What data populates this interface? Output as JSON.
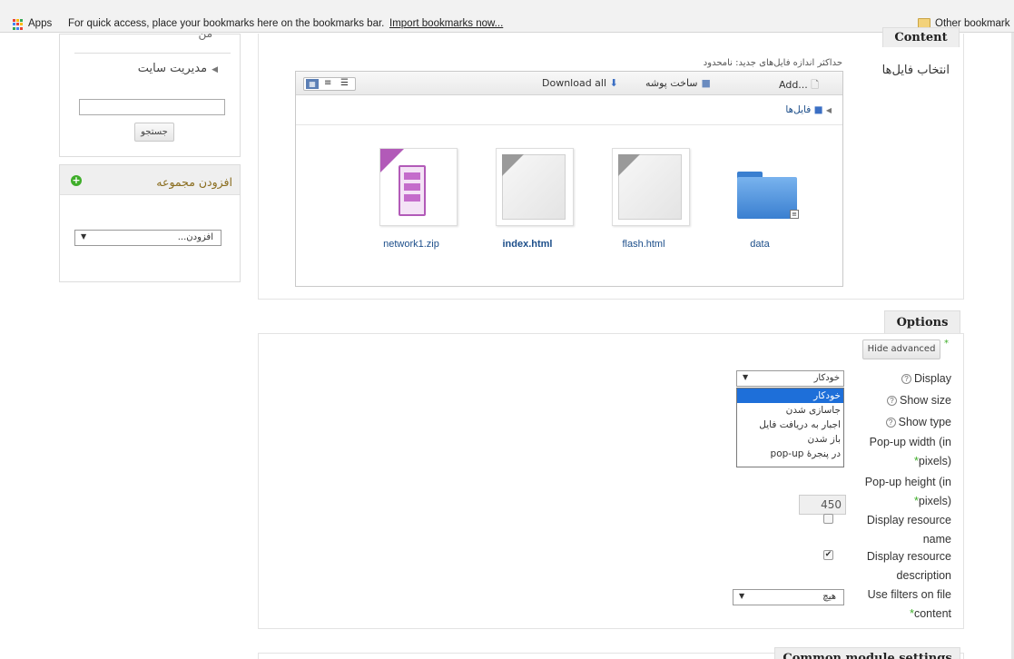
{
  "bookmarks_bar": {
    "apps_label": "Apps",
    "hint": "For quick access, place your bookmarks here on the bookmarks bar.",
    "import_link": "Import bookmarks now...",
    "other_bookmarks": "Other bookmark"
  },
  "sidebar": {
    "cut_text": "من",
    "admin_item": "مدیریت سایت",
    "search_value": "",
    "search_button": "جستجو",
    "add_block_title": "افزودن مجموعه",
    "add_select_value": "افزودن..."
  },
  "content_section": {
    "tab_label": "Content",
    "field_label": "انتخاب فایل‌ها",
    "max_size_note": "حداکثر اندازه فایل‌های جدید: نامحدود",
    "toolbar": {
      "add": "Add...",
      "create_folder": "ساخت پوشه",
      "download_all": "Download all"
    },
    "breadcrumb": "فایل‌ها",
    "files": [
      {
        "name": "network1.zip",
        "icon": "zip-archive-icon",
        "bold": false
      },
      {
        "name": "index.html",
        "icon": "html-file-icon",
        "bold": true
      },
      {
        "name": "flash.html",
        "icon": "html-file-icon",
        "bold": false
      },
      {
        "name": "data",
        "icon": "folder-icon",
        "bold": false
      }
    ]
  },
  "options_section": {
    "tab_label": "Options",
    "hide_advanced_button": "Hide advanced",
    "display": {
      "label": "Display",
      "selected": "خودکار",
      "options": [
        "خودکار",
        "جاسازی شدن",
        "اجبار به دریافت فایل",
        "باز شدن",
        "در پنجرهٔ pop-up"
      ]
    },
    "show_size_label": "Show size",
    "show_type_label": "Show type",
    "popup_width_label_1": "Pop-up width (in",
    "popup_width_label_2": "pixels)",
    "popup_height_label_1": "Pop-up height (in",
    "popup_height_label_2": "pixels)",
    "popup_height_value": "450",
    "display_name_label_1": "Display resource",
    "display_name_label_2": "name",
    "display_name_checked": false,
    "display_desc_label_1": "Display resource",
    "display_desc_label_2": "description",
    "display_desc_checked": true,
    "filters_label_1": "Use filters on file",
    "filters_label_2": "content",
    "filters_value": "هیچ",
    "check_mark": "✔"
  },
  "common_section": {
    "tab_label": "Common module settings"
  },
  "colors": {
    "accent_blue": "#1e6fd9",
    "required_green": "#3fae2a",
    "link_blue": "#1c4e8a"
  }
}
